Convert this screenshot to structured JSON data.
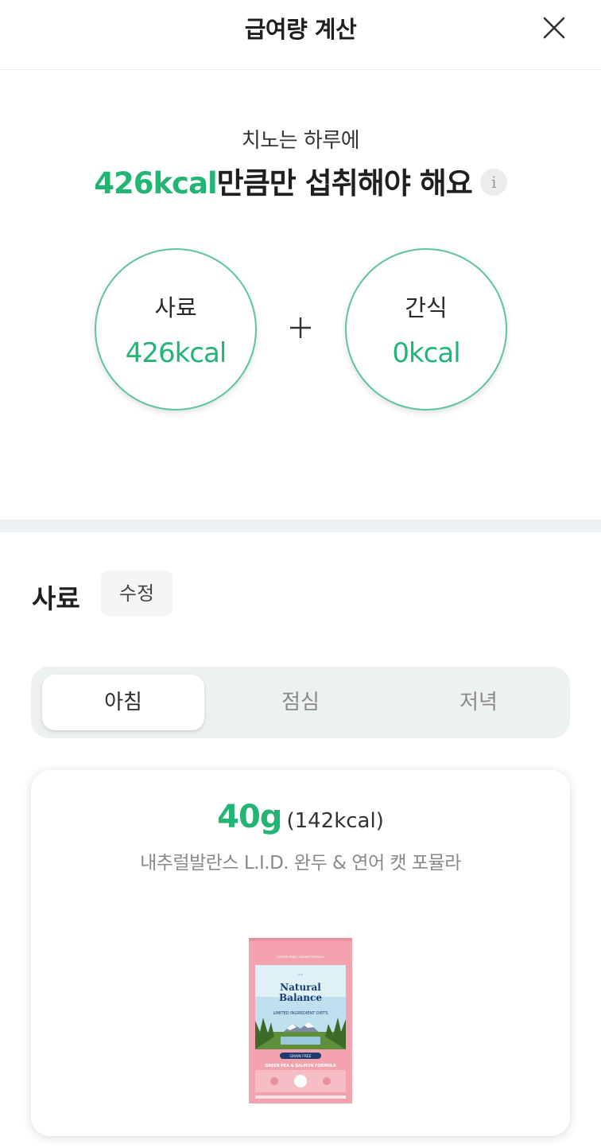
{
  "header": {
    "title": "급여량 계산",
    "close_icon": "close-icon"
  },
  "summary": {
    "intro": "치노는 하루에",
    "kcal": "426kcal",
    "suffix": "만큼만 섭취해야 해요",
    "info_label": "i"
  },
  "breakdown": {
    "food": {
      "label": "사료",
      "value": "426kcal"
    },
    "snack": {
      "label": "간식",
      "value": "0kcal"
    },
    "operator_icon": "plus-icon"
  },
  "food_section": {
    "title": "사료",
    "edit_label": "수정",
    "tabs": [
      {
        "label": "아침",
        "active": true
      },
      {
        "label": "점심",
        "active": false
      },
      {
        "label": "저녁",
        "active": false
      }
    ],
    "card": {
      "grams": "40g",
      "kcal": "(142kcal)",
      "product_name": "내추럴발란스 L.I.D. 완두 & 연어 캣 포뮬라",
      "package_text": {
        "brand_line1": "Natural",
        "brand_line2": "Balance",
        "line": "LIMITED INGREDIENT DIETS",
        "badge": "GRAIN FREE",
        "formula": "GREEN PEA & SALMON FORMULA"
      }
    }
  },
  "colors": {
    "accent": "#22b573",
    "circle_border": "#5ec59b",
    "package_pink": "#f3a3ad"
  }
}
